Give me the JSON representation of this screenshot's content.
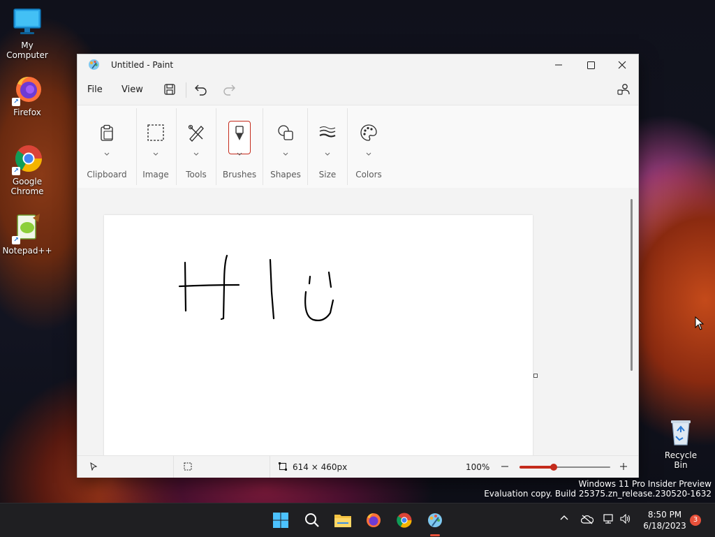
{
  "desktop": {
    "icons": [
      {
        "label": "My Computer"
      },
      {
        "label": "Firefox"
      },
      {
        "label": "Google Chrome"
      },
      {
        "label": "Notepad++"
      },
      {
        "label": "Recycle Bin"
      }
    ]
  },
  "window": {
    "title": "Untitled - Paint",
    "menu": [
      "File",
      "View"
    ]
  },
  "ribbon": {
    "groups": [
      {
        "label": "Clipboard",
        "icon": "clipboard-icon"
      },
      {
        "label": "Image",
        "icon": "selection-icon"
      },
      {
        "label": "Tools",
        "icon": "tools-icon"
      },
      {
        "label": "Brushes",
        "icon": "brush-icon",
        "active": true
      },
      {
        "label": "Shapes",
        "icon": "shapes-icon"
      },
      {
        "label": "Size",
        "icon": "size-icon"
      },
      {
        "label": "Colors",
        "icon": "palette-icon"
      }
    ]
  },
  "canvas": {
    "drawing_text": "HIU"
  },
  "status": {
    "canvas_size": "614 × 460px",
    "zoom": "100%",
    "zoom_fraction": 0.38
  },
  "watermark": {
    "line1": "Windows 11 Pro Insider Preview",
    "line2": "Evaluation copy. Build 25375.zn_release.230520-1632"
  },
  "taskbar": {
    "time": "8:50 PM",
    "date": "6/18/2023",
    "notifications": "3"
  },
  "colors": {
    "accent": "#c42b1c",
    "taskbar": "#1f1f22"
  }
}
